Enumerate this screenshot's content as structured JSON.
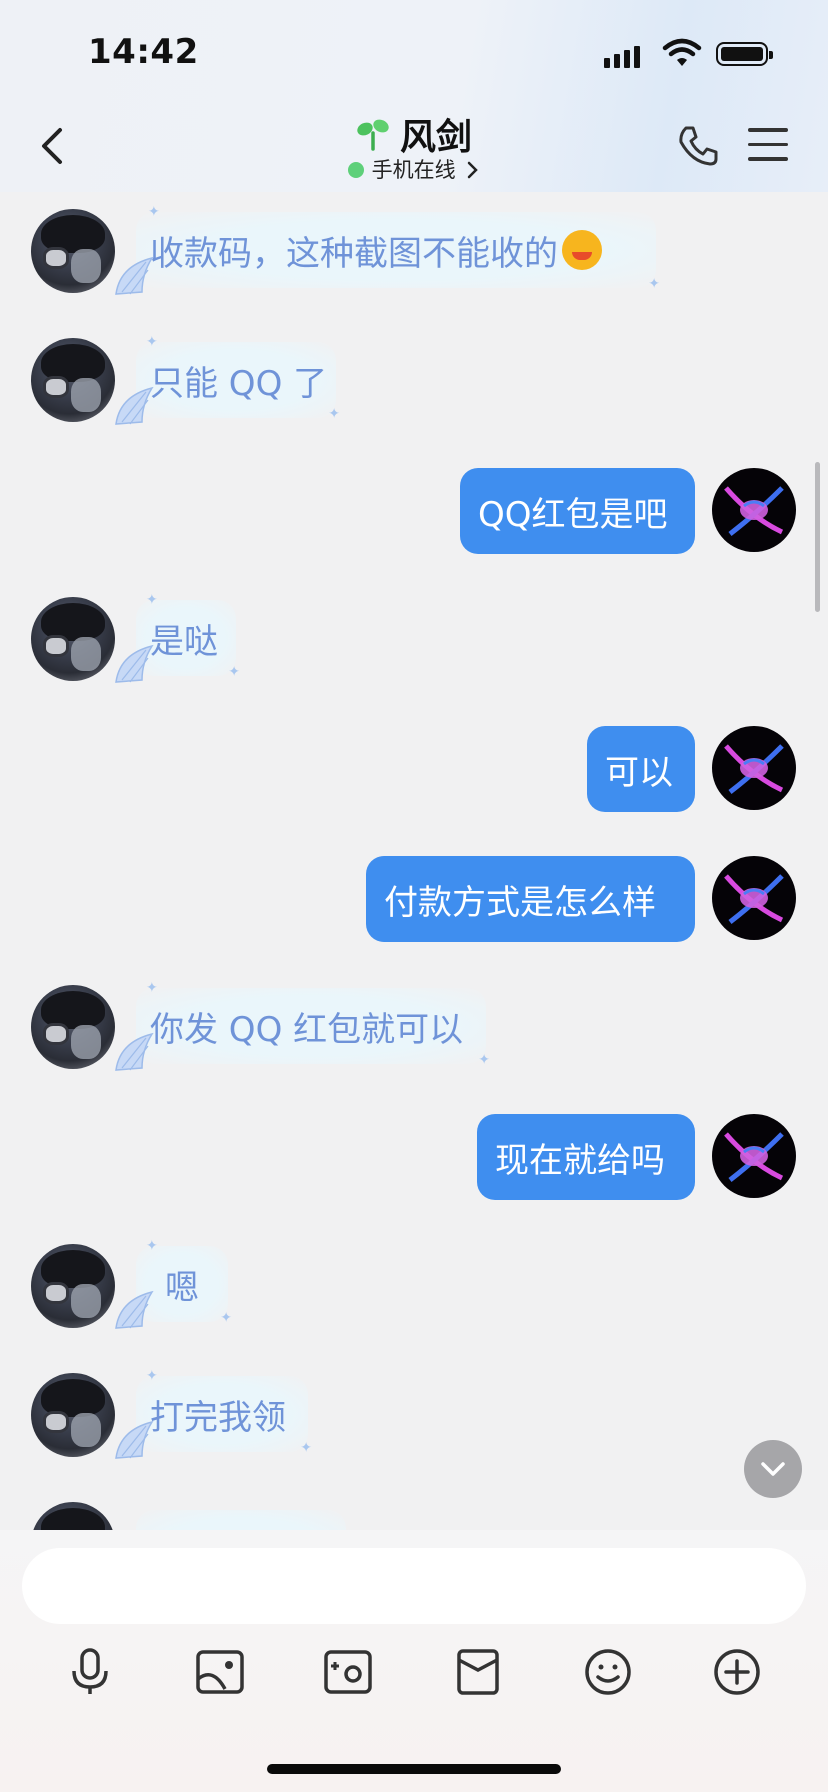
{
  "status_bar": {
    "time": "14:42"
  },
  "header": {
    "title": "风剑",
    "subtitle": "手机在线",
    "title_icon": "sprout-icon"
  },
  "messages": [
    {
      "side": "left",
      "text": "收款码，这种截图不能收的",
      "emoji": "laughing-tears-emoji"
    },
    {
      "side": "left",
      "text": "只能 QQ 了"
    },
    {
      "side": "right",
      "text": "QQ红包是吧"
    },
    {
      "side": "left",
      "text": "是哒"
    },
    {
      "side": "right",
      "text": "可以"
    },
    {
      "side": "right",
      "text": "付款方式是怎么样"
    },
    {
      "side": "left",
      "text": "你发 QQ 红包就可以"
    },
    {
      "side": "right",
      "text": "现在就给吗"
    },
    {
      "side": "left",
      "text": "嗯"
    },
    {
      "side": "left",
      "text": "打完我领"
    }
  ],
  "input": {
    "placeholder": ""
  },
  "toolbar": [
    "microphone-icon",
    "image-icon",
    "camera-icon",
    "red-envelope-icon",
    "emoji-icon",
    "plus-icon"
  ],
  "colors": {
    "accent": "#3f8eef",
    "left_text": "#6f93d8",
    "online": "#5ed07a"
  }
}
